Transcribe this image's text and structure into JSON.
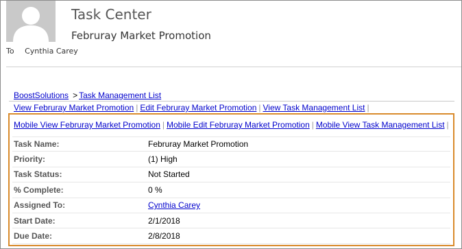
{
  "header": {
    "app_title": "Task Center",
    "subject": "Februray Market Promotion",
    "to_label": "To",
    "to_name": "Cynthia Carey"
  },
  "breadcrumb": {
    "site": "BoostSolutions",
    "separator": ">",
    "list": "Task Management List"
  },
  "actions": [
    {
      "label": "View Februray Market Promotion"
    },
    {
      "label": "Edit Februray Market Promotion"
    },
    {
      "label": "View Task Management List"
    }
  ],
  "mobile_actions": [
    {
      "label": "Mobile View Februray Market Promotion"
    },
    {
      "label": "Mobile Edit Februray Market Promotion"
    },
    {
      "label": "Mobile View Task Management List"
    }
  ],
  "properties": [
    {
      "label": "Task Name:",
      "value": "Februray Market Promotion"
    },
    {
      "label": "Priority:",
      "value": "(1) High"
    },
    {
      "label": "Task Status:",
      "value": "Not Started"
    },
    {
      "label": "% Complete:",
      "value": "0 %"
    },
    {
      "label": "Assigned To:",
      "value": "Cynthia Carey"
    },
    {
      "label": "Start Date:",
      "value": "2/1/2018"
    },
    {
      "label": "Due Date:",
      "value": "2/8/2018"
    }
  ],
  "pipe": "|",
  "colors": {
    "highlight_border": "#d98a2b",
    "link": "#0000cc",
    "label": "#555555"
  }
}
